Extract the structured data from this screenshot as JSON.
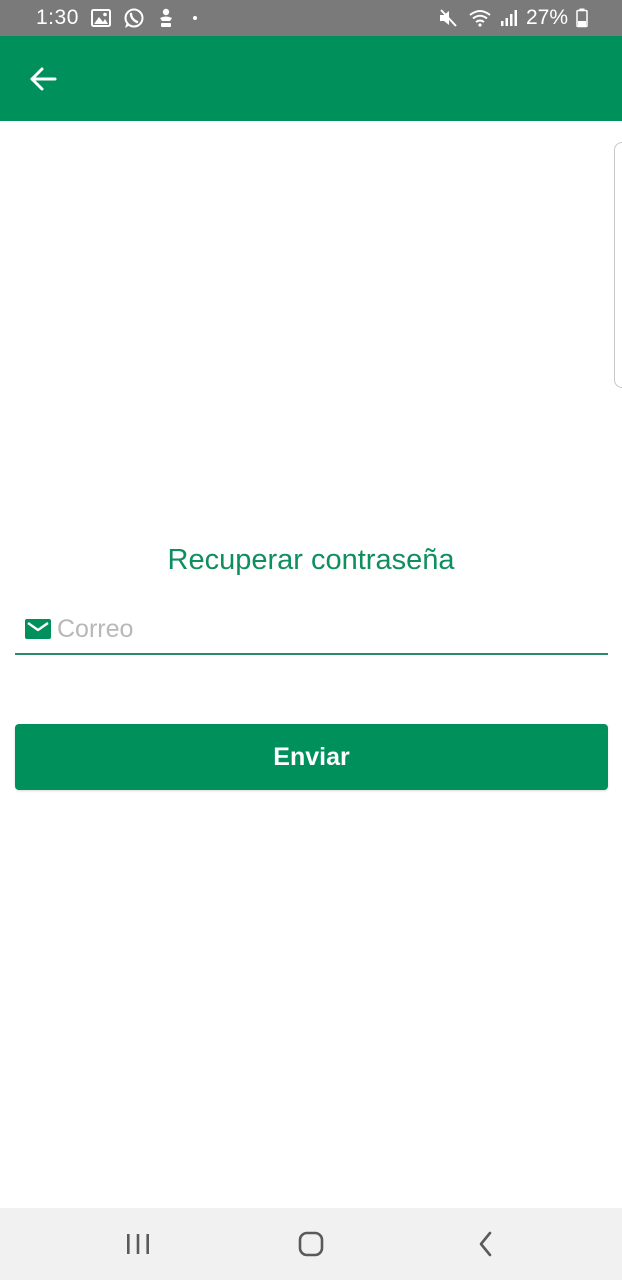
{
  "status_bar": {
    "time": "1:30",
    "battery": "27%",
    "left_icons": [
      "gallery-icon",
      "whatsapp-icon",
      "notification-icon",
      "dot-icon"
    ],
    "right_icons": [
      "mute-icon",
      "wifi-icon",
      "signal-icon",
      "battery-icon"
    ]
  },
  "app_bar": {
    "color": "#00905b",
    "back_icon": "arrow-back-icon"
  },
  "main": {
    "title": "Recuperar contraseña",
    "email": {
      "icon": "mail-icon",
      "placeholder": "Correo",
      "value": ""
    },
    "submit_label": "Enviar"
  },
  "nav_bar": {
    "buttons": [
      "recents-icon",
      "home-icon",
      "back-icon"
    ]
  }
}
